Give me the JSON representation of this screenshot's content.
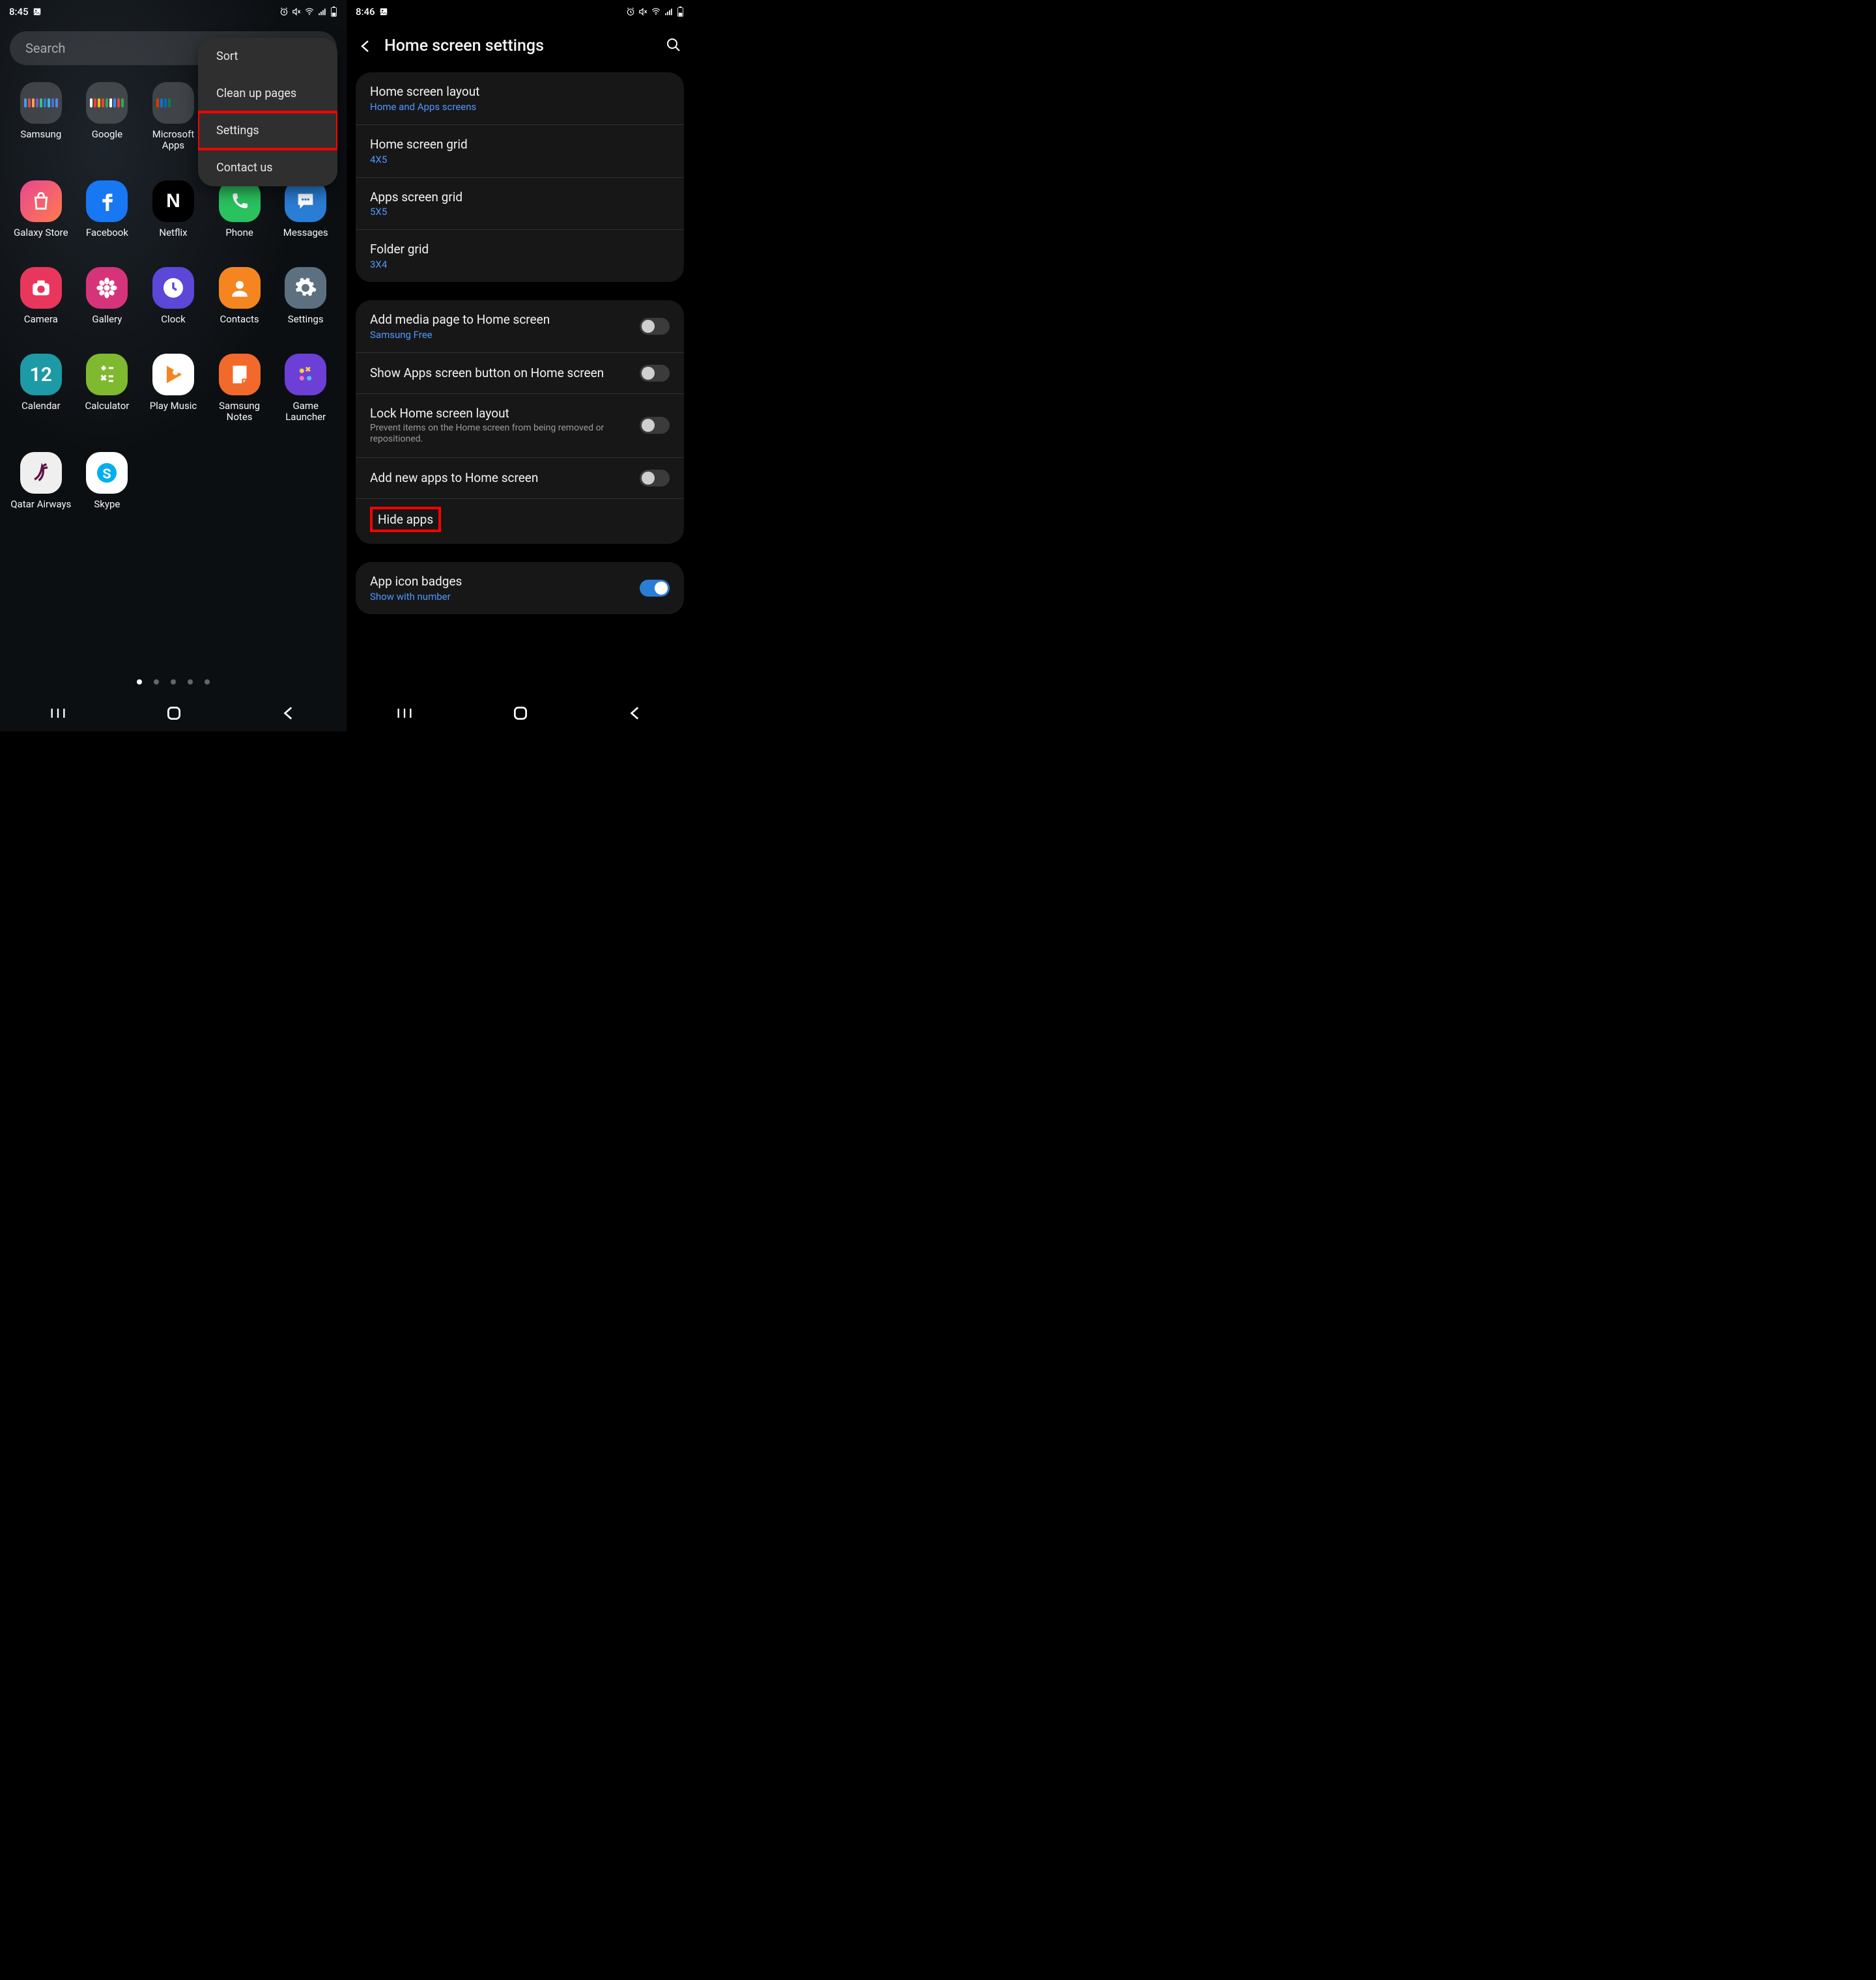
{
  "left": {
    "status": {
      "time": "8:45"
    },
    "search_placeholder": "Search",
    "dropdown": {
      "sort": "Sort",
      "clean": "Clean up pages",
      "settings": "Settings",
      "contact": "Contact us"
    },
    "apps": {
      "samsung": "Samsung",
      "google": "Google",
      "msapps": "Microsoft Apps",
      "galaxystore": "Galaxy Store",
      "facebook": "Facebook",
      "netflix": "Netflix",
      "phone": "Phone",
      "messages": "Messages",
      "camera": "Camera",
      "gallery": "Gallery",
      "clock": "Clock",
      "contacts": "Contacts",
      "settings": "Settings",
      "calendar": "Calendar",
      "calendar_num": "12",
      "calculator": "Calculator",
      "playmusic": "Play Music",
      "notes": "Samsung Notes",
      "gamelauncher": "Game Launcher",
      "qatar": "Qatar Airways",
      "skype": "Skype"
    }
  },
  "right": {
    "status": {
      "time": "8:46"
    },
    "title": "Home screen settings",
    "rows": {
      "layout_t": "Home screen layout",
      "layout_s": "Home and Apps screens",
      "hgrid_t": "Home screen grid",
      "hgrid_s": "4X5",
      "agrid_t": "Apps screen grid",
      "agrid_s": "5X5",
      "fgrid_t": "Folder grid",
      "fgrid_s": "3X4",
      "media_t": "Add media page to Home screen",
      "media_s": "Samsung Free",
      "showapps_t": "Show Apps screen button on Home screen",
      "lock_t": "Lock Home screen layout",
      "lock_d": "Prevent items on the Home screen from being removed or repositioned.",
      "addnew_t": "Add new apps to Home screen",
      "hide_t": "Hide apps",
      "badges_t": "App icon badges",
      "badges_s": "Show with number"
    }
  }
}
